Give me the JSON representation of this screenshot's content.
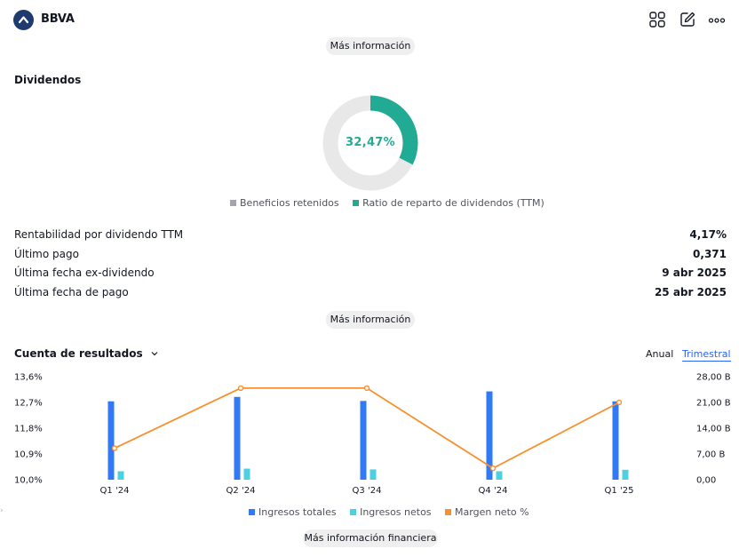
{
  "header": {
    "symbol": "BBVA",
    "icons": [
      "grid-icon",
      "edit-icon",
      "more-icon"
    ]
  },
  "more_info_top": "Más información",
  "dividends": {
    "title": "Dividendos",
    "payout_ratio_label": "32,47%",
    "payout_ratio_value": 32.47,
    "legend": [
      {
        "name": "Beneficios retenidos",
        "color": "#a3a6af"
      },
      {
        "name": "Ratio de reparto de dividendos (TTM)",
        "color": "#22ab94"
      }
    ],
    "stats": [
      {
        "label": "Rentabilidad por dividendo TTM",
        "value": "4,17%"
      },
      {
        "label": "Último pago",
        "value": "0,371"
      },
      {
        "label": "Última fecha ex-dividendo",
        "value": "9 abr 2025"
      },
      {
        "label": "Última fecha de pago",
        "value": "25 abr 2025"
      }
    ],
    "more_info": "Más información"
  },
  "income": {
    "title": "Cuenta de resultados",
    "tabs": [
      "Anual",
      "Trimestral"
    ],
    "active_tab": "Trimestral",
    "more_info": "Más información financiera"
  },
  "colors": {
    "revenue": "#3179f5",
    "net_income": "#4dd0e1",
    "net_margin": "#f7902f",
    "donut_track": "#e8e8e8",
    "donut_fill": "#22ab94"
  },
  "chart_data": {
    "type": "bar",
    "categories": [
      "Q1 '24",
      "Q2 '24",
      "Q3 '24",
      "Q4 '24",
      "Q1 '25"
    ],
    "left_axis_ticks": [
      "13,6%",
      "12,7%",
      "11,8%",
      "10,9%",
      "10,0%"
    ],
    "right_axis_ticks": [
      "28,00 B",
      "21,00 B",
      "14,00 B",
      "7,00 B",
      "0,00"
    ],
    "left_ylim": [
      10.0,
      13.6
    ],
    "right_ylim": [
      0,
      28
    ],
    "series": [
      {
        "name": "Ingresos totales",
        "axis": "right",
        "kind": "bar",
        "values": [
          21.3,
          22.5,
          21.4,
          24.0,
          21.3
        ]
      },
      {
        "name": "Ingresos netos",
        "axis": "right",
        "kind": "bar",
        "values": [
          2.3,
          3.0,
          2.8,
          2.3,
          2.7
        ]
      },
      {
        "name": "Margen neto %",
        "axis": "left",
        "kind": "line",
        "values": [
          11.1,
          13.2,
          13.2,
          10.4,
          12.7
        ]
      }
    ],
    "legend": [
      "Ingresos totales",
      "Ingresos netos",
      "Margen neto %"
    ],
    "legend_position": "bottom"
  }
}
